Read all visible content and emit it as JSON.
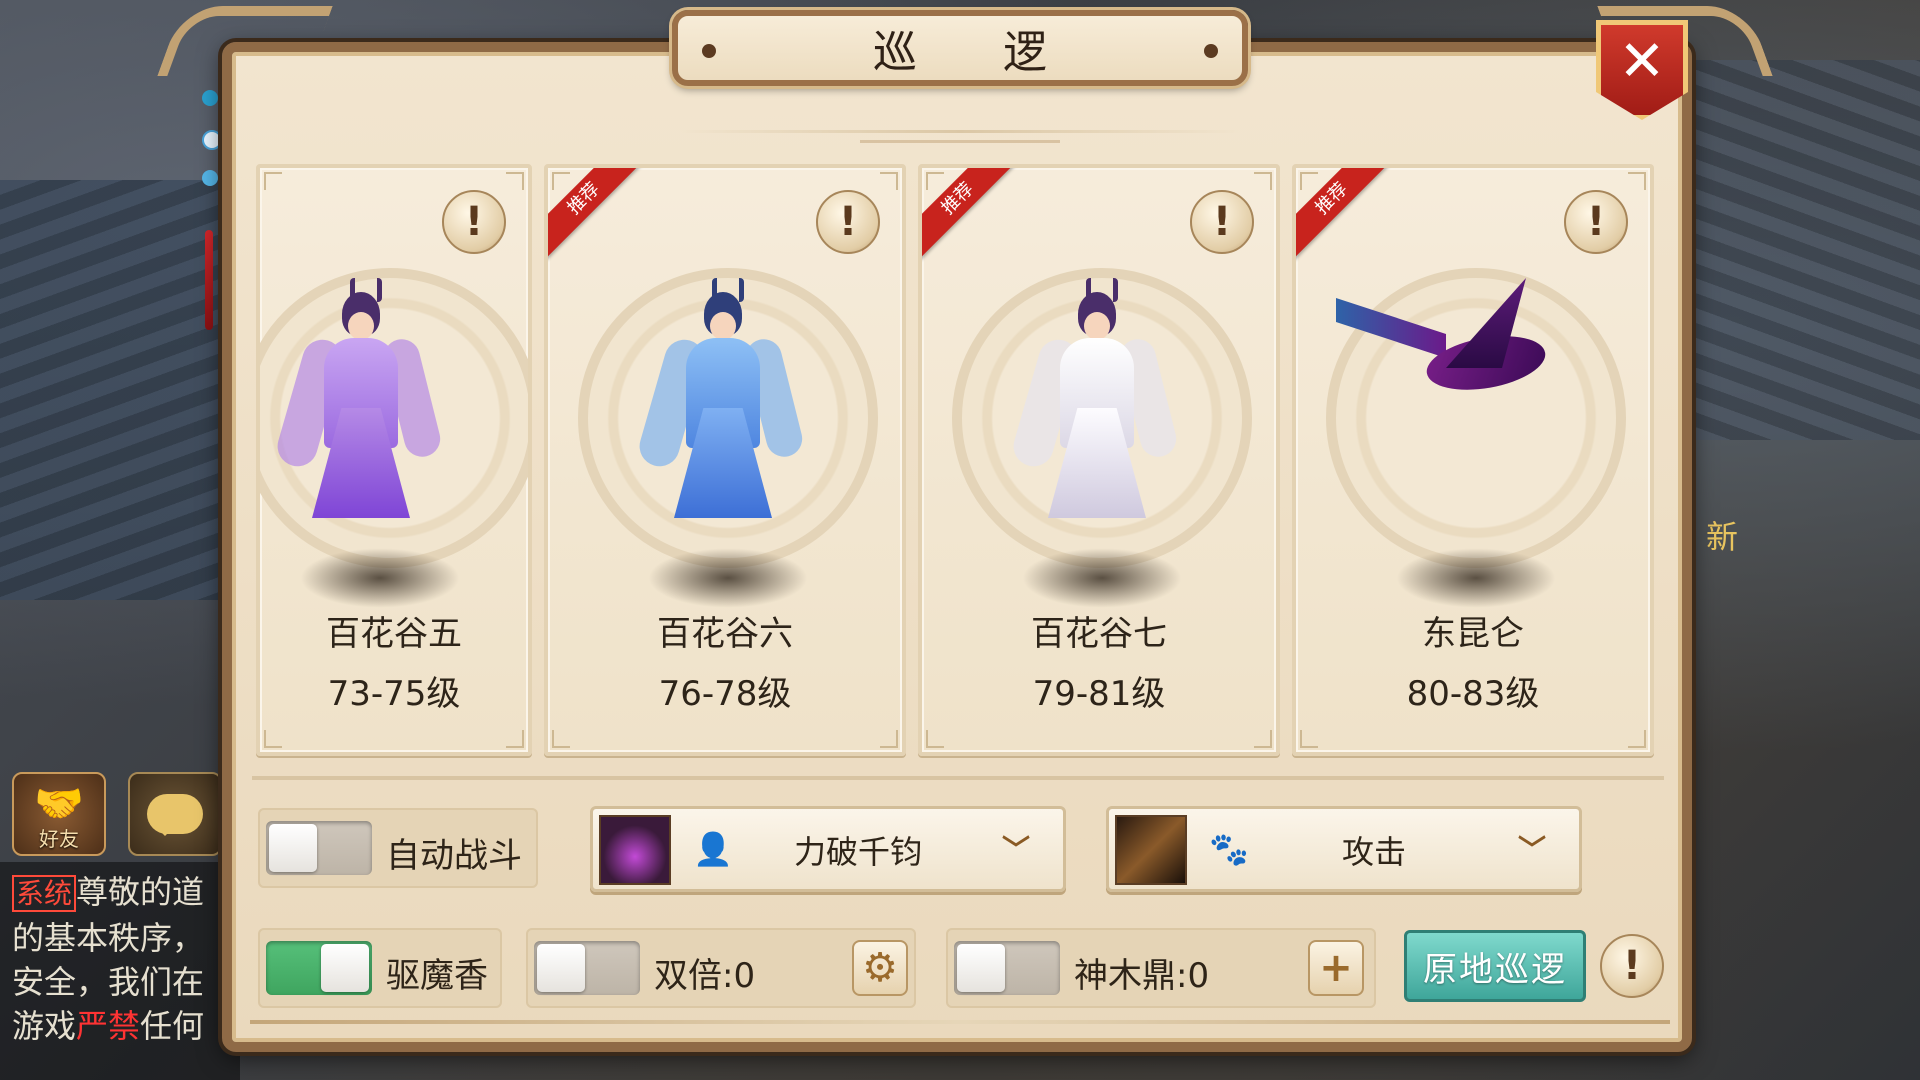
{
  "dialog": {
    "title": "巡 逻",
    "close_label": "✕"
  },
  "cards": [
    {
      "name": "百花谷五",
      "level": "73-75级",
      "recommended": false,
      "figure": "purple-fairy"
    },
    {
      "name": "百花谷六",
      "level": "76-78级",
      "recommended": true,
      "ribbon": "推荐",
      "figure": "blue-fairy"
    },
    {
      "name": "百花谷七",
      "level": "79-81级",
      "recommended": true,
      "ribbon": "推荐",
      "figure": "white-fairy"
    },
    {
      "name": "东昆仑",
      "level": "80-83级",
      "recommended": true,
      "ribbon": "推荐",
      "figure": "purple-bird"
    }
  ],
  "info_icon": "!",
  "controls": {
    "auto_battle": {
      "label": "自动战斗",
      "on": false
    },
    "skill_select": {
      "value": "力破千钧"
    },
    "pet_select": {
      "value": "攻击"
    },
    "demon_incense": {
      "label": "驱魔香",
      "on": true
    },
    "double": {
      "label": "双倍:0",
      "on": false
    },
    "shenmu": {
      "label": "神木鼎:0",
      "on": false
    },
    "patrol_button": "原地巡逻"
  },
  "side": {
    "friends_label": "好友",
    "new_label": "新"
  },
  "chat": {
    "system_tag": "系统",
    "line1": "尊敬的道",
    "line2": "的基本秩序，",
    "line3": "安全，我们在",
    "line4_prefix": "游戏",
    "line4_red": "严禁",
    "line4_suffix": "任何"
  },
  "colors": {
    "panel_bg": "#efe2c9",
    "ribbon": "#c8231d",
    "toggle_on": "#4cb46c",
    "patrol_button": "#4fb3a7"
  }
}
